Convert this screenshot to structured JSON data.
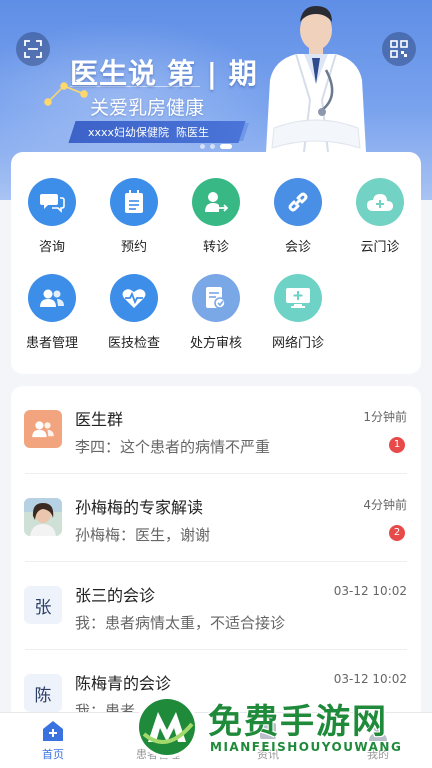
{
  "banner": {
    "title_main": "医生说",
    "title_issue": "第 | 期",
    "subtitle": "关爱乳房健康",
    "hospital": "xxxx妇幼保健院",
    "doctor_name": "陈医生"
  },
  "quick_menu": [
    {
      "label": "咨询",
      "icon": "chat-bubbles-icon",
      "color": "#3d8ee8"
    },
    {
      "label": "预约",
      "icon": "notepad-icon",
      "color": "#3d8ee8"
    },
    {
      "label": "转诊",
      "icon": "referral-icon",
      "color": "#37b884"
    },
    {
      "label": "会诊",
      "icon": "link-icon",
      "color": "#4a8fe6"
    },
    {
      "label": "云门诊",
      "icon": "cloud-plus-icon",
      "color": "#72d3c4"
    },
    {
      "label": "患者管理",
      "icon": "users-icon",
      "color": "#3d8ee8"
    },
    {
      "label": "医技检查",
      "icon": "heart-pulse-icon",
      "color": "#3d8ee8"
    },
    {
      "label": "处方审核",
      "icon": "prescription-icon",
      "color": "#7aa7e6"
    },
    {
      "label": "网络门诊",
      "icon": "monitor-plus-icon",
      "color": "#6fd2c6"
    }
  ],
  "messages": [
    {
      "title": "医生群",
      "preview": "李四：这个患者的病情不严重",
      "time": "1分钟前",
      "badge": "1",
      "avatar_type": "group-icon"
    },
    {
      "title": "孙梅梅的专家解读",
      "preview": "孙梅梅：医生，谢谢",
      "time": "4分钟前",
      "badge": "2",
      "avatar_type": "photo"
    },
    {
      "title": "张三的会诊",
      "preview": "我：患者病情太重，不适合接诊",
      "time": "03-12 10:02",
      "badge": "",
      "avatar_letter": "张"
    },
    {
      "title": "陈梅青的会诊",
      "preview": "我：患者...",
      "time": "03-12 10:02",
      "badge": "",
      "avatar_letter": "陈"
    }
  ],
  "tabs": [
    {
      "label": "首页",
      "active": true
    },
    {
      "label": "患者管理",
      "active": false
    },
    {
      "label": "资讯",
      "active": false
    },
    {
      "label": "我的",
      "active": false
    }
  ],
  "watermark": {
    "text": "免费手游网",
    "subtext": "MIANFEISHOUYOUWANG"
  },
  "colors": {
    "accent": "#3a72e0",
    "badge": "#e84a4a",
    "watermark": "#1f8a3a"
  }
}
